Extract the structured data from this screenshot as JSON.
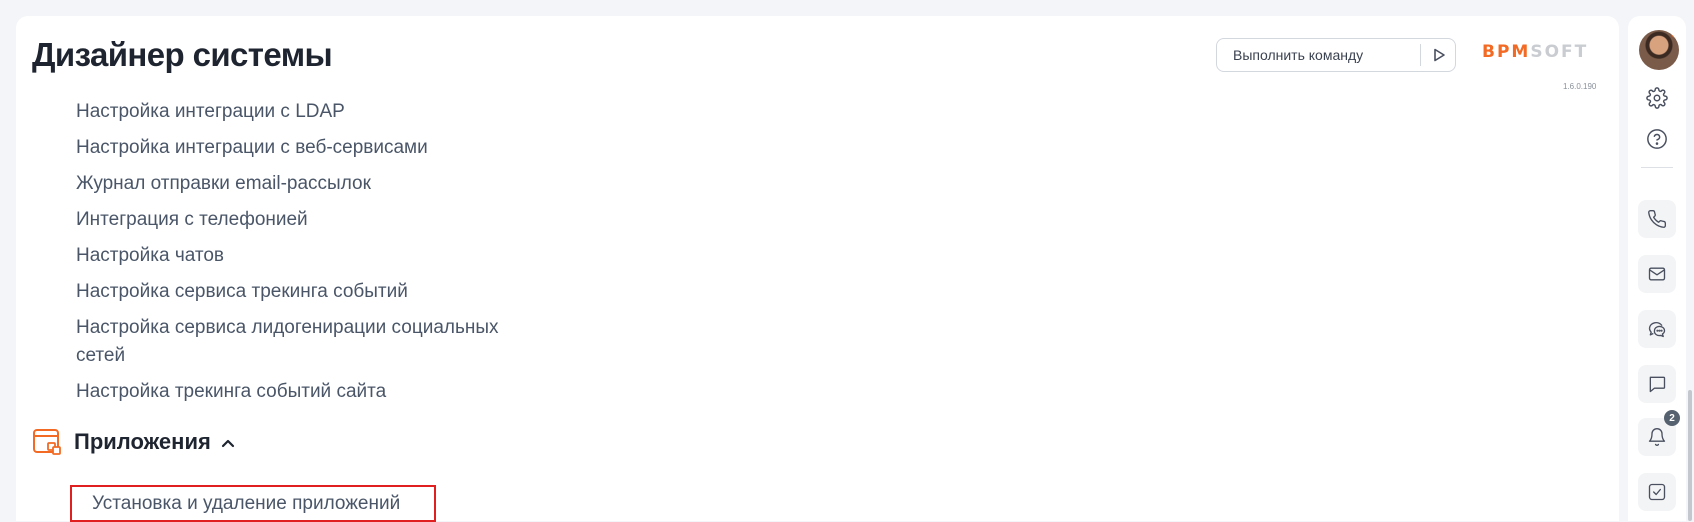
{
  "header": {
    "title": "Дизайнер системы",
    "command": {
      "placeholder": "Выполнить команду"
    },
    "logo": {
      "part1": "BPM",
      "part2": "SOFT",
      "accent_color": "#f26a23"
    },
    "version": "1.6.0.190"
  },
  "nav": {
    "items": [
      {
        "label": "Настройка интеграции с LDAP"
      },
      {
        "label": "Настройка интеграции с веб-сервисами"
      },
      {
        "label": "Журнал отправки email-рассылок"
      },
      {
        "label": "Интеграция с телефонией"
      },
      {
        "label": "Настройка чатов"
      },
      {
        "label": "Настройка сервиса трекинга событий"
      },
      {
        "label": "Настройка сервиса лидогенирации социальных сетей"
      },
      {
        "label": "Настройка трекинга событий сайта"
      }
    ],
    "section": {
      "label": "Приложения",
      "icon": "applications-icon",
      "expanded": true,
      "items": [
        {
          "label": "Установка и удаление приложений",
          "highlighted": true
        }
      ]
    }
  },
  "right_panel": {
    "icons": [
      "avatar",
      "gear-icon",
      "help-icon",
      "phone-icon",
      "mail-icon",
      "chat-bubbles-icon",
      "message-icon",
      "bell-icon",
      "task-check-icon"
    ],
    "notifications_count": "2"
  }
}
